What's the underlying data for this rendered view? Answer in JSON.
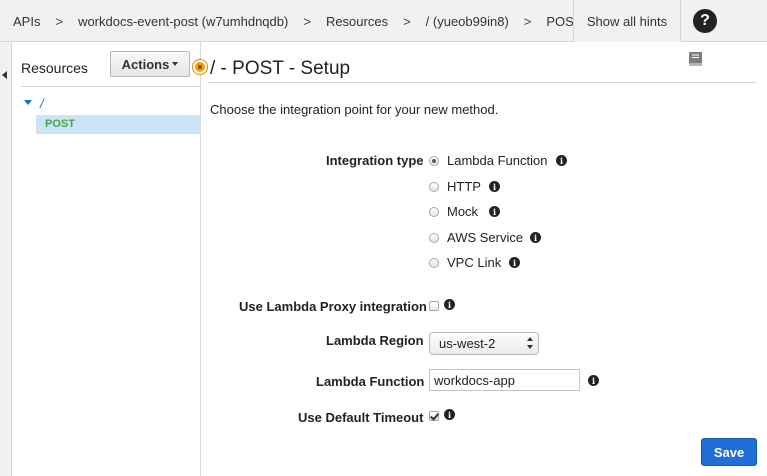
{
  "breadcrumb": {
    "items": [
      "APIs",
      "workdocs-event-post (w7umhdnqdb)",
      "Resources",
      "/ (yueob99in8)",
      "POST"
    ],
    "separator": ">"
  },
  "header": {
    "hints_label": "Show all hints",
    "help_label": "?"
  },
  "resources": {
    "title": "Resources",
    "actions_label": "Actions",
    "tree_root": "/",
    "tree_method": "POST"
  },
  "main": {
    "title": "/ - POST - Setup",
    "intro": "Choose the integration point for your new method.",
    "integration_type_label": "Integration type",
    "integration_options": [
      "Lambda Function",
      "HTTP",
      "Mock",
      "AWS Service",
      "VPC Link"
    ],
    "selected_integration": "Lambda Function",
    "proxy_label": "Use Lambda Proxy integration",
    "proxy_checked": false,
    "region_label": "Lambda Region",
    "region_value": "us-west-2",
    "function_label": "Lambda Function",
    "function_value": "workdocs-app",
    "timeout_label": "Use Default Timeout",
    "timeout_checked": true,
    "save_label": "Save"
  },
  "colors": {
    "accent": "#1f6fd6",
    "tree_selected_bg": "#cde4f7",
    "method_green": "#3ea93e",
    "connector_orange": "#f4a000"
  }
}
